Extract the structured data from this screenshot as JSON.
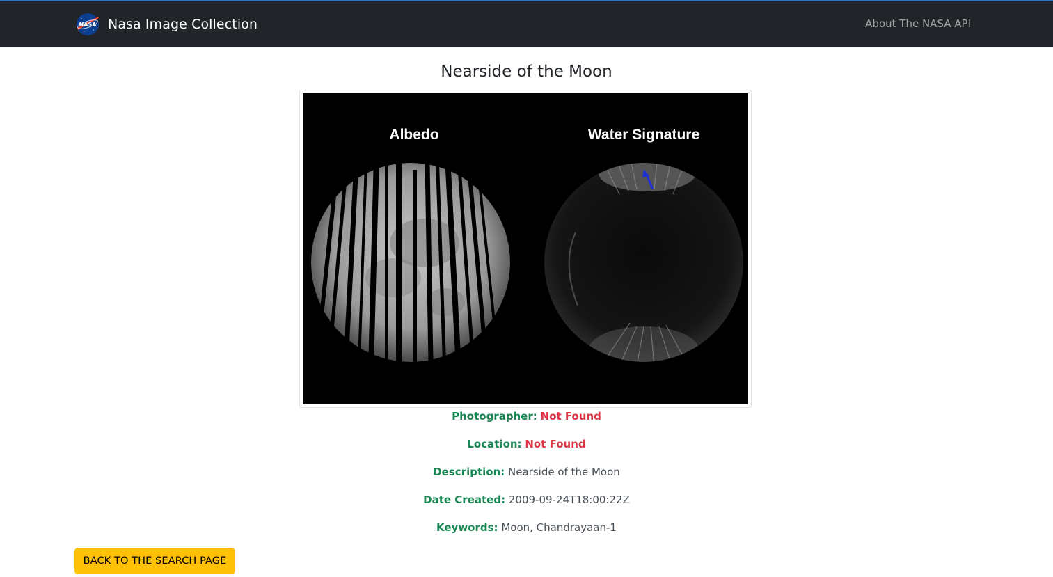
{
  "navbar": {
    "brand_logo_text": "NASA",
    "brand_title": "Nasa Image Collection",
    "about_link": "About The NASA API"
  },
  "page": {
    "title": "Nearside of the Moon"
  },
  "image": {
    "left_label": "Albedo",
    "right_label": "Water Signature"
  },
  "details": {
    "photographer": {
      "label": "Photographer:",
      "value": "Not Found"
    },
    "location": {
      "label": "Location:",
      "value": "Not Found"
    },
    "description": {
      "label": "Description:",
      "value": "Nearside of the Moon"
    },
    "date_created": {
      "label": "Date Created:",
      "value": "2009-09-24T18:00:22Z"
    },
    "keywords": {
      "label": "Keywords:",
      "value": "Moon, Chandrayaan-1"
    }
  },
  "actions": {
    "back_label": "BACK TO THE SEARCH PAGE"
  },
  "colors": {
    "navbar": "#212529",
    "label_green": "#198754",
    "not_found_red": "#dc3545",
    "button_yellow": "#ffc107"
  }
}
